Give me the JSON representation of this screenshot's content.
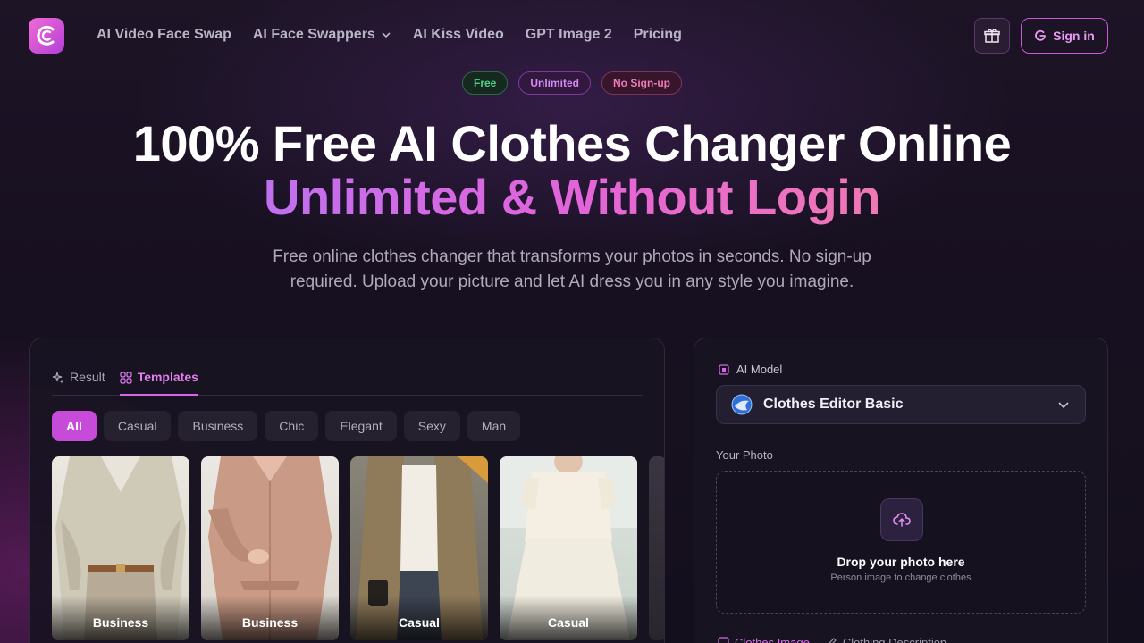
{
  "header": {
    "nav": [
      {
        "label": "AI Video Face Swap"
      },
      {
        "label": "AI Face Swappers",
        "has_dropdown": true
      },
      {
        "label": "AI Kiss Video"
      },
      {
        "label": "GPT Image 2"
      },
      {
        "label": "Pricing"
      }
    ],
    "gift_icon": "gift-icon",
    "signin_label": "Sign in"
  },
  "badges": {
    "free": "Free",
    "unlimited": "Unlimited",
    "nosignup": "No Sign-up"
  },
  "hero": {
    "title": "100% Free AI Clothes Changer Online",
    "subtitle": "Unlimited & Without Login",
    "description": "Free online clothes changer that transforms your photos in seconds. No sign-up required. Upload your picture and let AI dress you in any style you imagine."
  },
  "left_panel": {
    "tabs": [
      {
        "label": "Result",
        "active": false
      },
      {
        "label": "Templates",
        "active": true
      }
    ],
    "filters": [
      "All",
      "Casual",
      "Business",
      "Chic",
      "Elegant",
      "Sexy",
      "Man"
    ],
    "active_filter": "All",
    "templates": [
      {
        "label": "Business"
      },
      {
        "label": "Business"
      },
      {
        "label": "Casual"
      },
      {
        "label": "Casual"
      }
    ]
  },
  "right_panel": {
    "model_label": "AI Model",
    "model_name": "Clothes Editor Basic",
    "photo_label": "Your Photo",
    "drop_title": "Drop your photo here",
    "drop_sub": "Person image to change clothes",
    "bottom_tabs": [
      "Clothes Image",
      "Clothing Description"
    ]
  },
  "colors": {
    "accent": "#d865e8",
    "background": "#171020"
  }
}
